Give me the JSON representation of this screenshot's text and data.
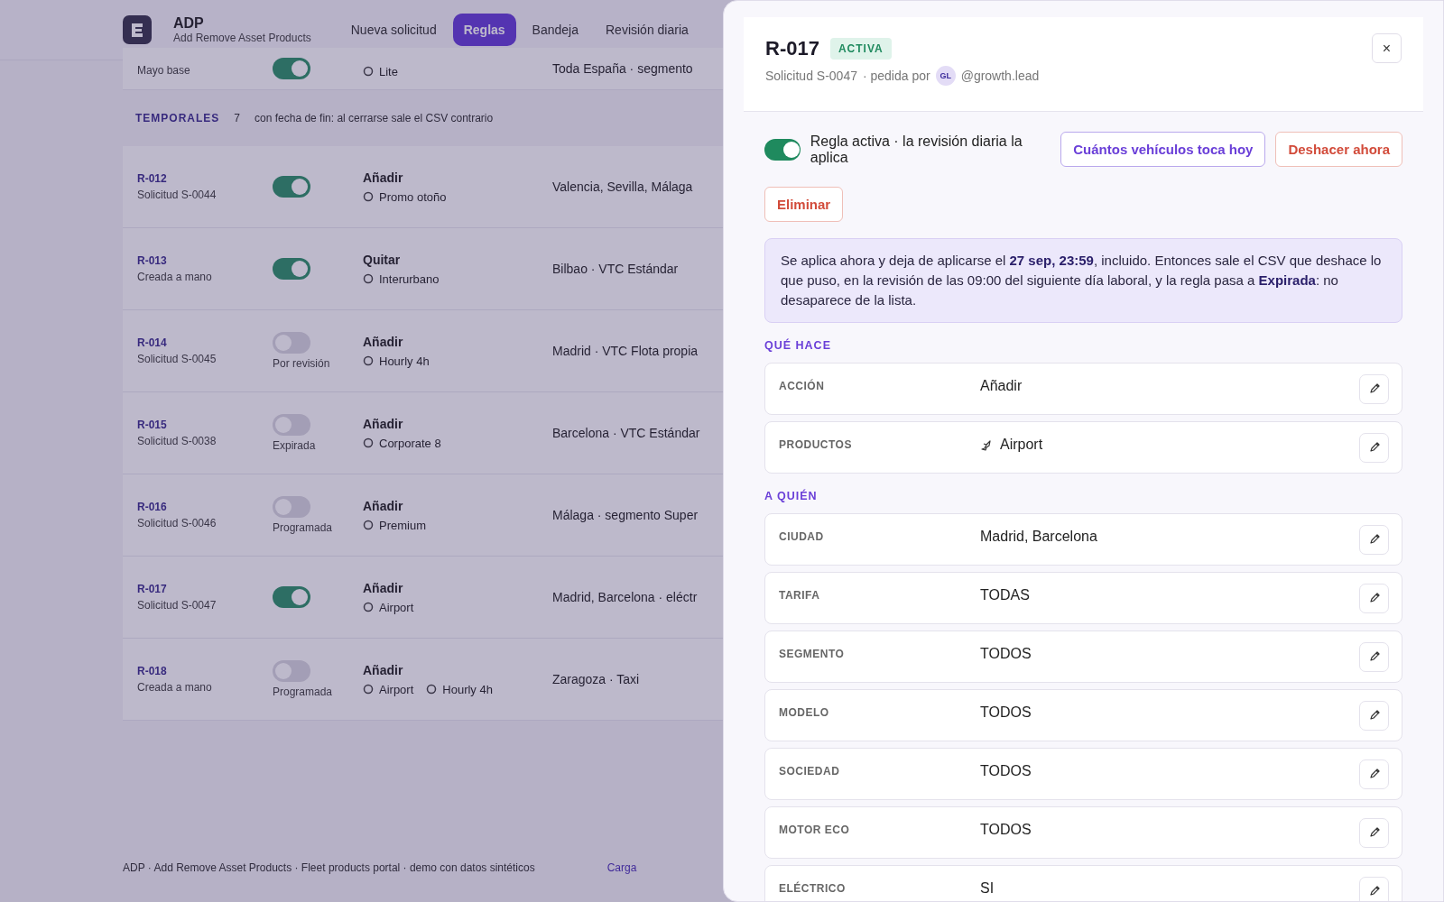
{
  "app": {
    "brand": "ADP",
    "subtitle": "Add Remove Asset Products",
    "nav": [
      {
        "label": "Nueva solicitud",
        "selected": false
      },
      {
        "label": "Reglas",
        "selected": true
      },
      {
        "label": "Bandeja",
        "selected": false
      },
      {
        "label": "Revisión diaria",
        "selected": false
      }
    ]
  },
  "rules_list": {
    "partial_row": {
      "sub": "Mayo base",
      "on": true,
      "product": "Lite",
      "target": "Toda España · segmento"
    },
    "section": {
      "title": "TEMPORALES",
      "count": "7",
      "note": "con fecha de fin: al cerrarse sale el CSV contrario"
    },
    "rows": [
      {
        "id": "R-012",
        "sub": "Solicitud S-0044",
        "on": true,
        "action": "Añadir",
        "products": [
          "Promo otoño"
        ],
        "target": "Valencia, Sevilla, Málaga"
      },
      {
        "id": "R-013",
        "sub": "Creada a mano",
        "on": true,
        "action": "Quitar",
        "products": [
          "Interurbano"
        ],
        "target": "Bilbao · VTC Estándar"
      },
      {
        "id": "R-014",
        "sub": "Solicitud S-0045",
        "on": false,
        "status": "Por revisión",
        "action": "Añadir",
        "products": [
          "Hourly 4h"
        ],
        "target": "Madrid · VTC Flota propia"
      },
      {
        "id": "R-015",
        "sub": "Solicitud S-0038",
        "on": false,
        "status": "Expirada",
        "action": "Añadir",
        "products": [
          "Corporate 8"
        ],
        "target": "Barcelona · VTC Estándar"
      },
      {
        "id": "R-016",
        "sub": "Solicitud S-0046",
        "on": false,
        "status": "Programada",
        "action": "Añadir",
        "products": [
          "Premium"
        ],
        "target": "Málaga · segmento Super"
      },
      {
        "id": "R-017",
        "sub": "Solicitud S-0047",
        "on": true,
        "action": "Añadir",
        "products": [
          "Airport"
        ],
        "target": "Madrid, Barcelona · eléctr"
      },
      {
        "id": "R-018",
        "sub": "Creada a mano",
        "on": false,
        "status": "Programada",
        "action": "Añadir",
        "products": [
          "Airport",
          "Hourly 4h"
        ],
        "target": "Zaragoza · Taxi"
      }
    ]
  },
  "footer": {
    "text": "ADP · Add Remove Asset Products · Fleet products portal · demo con datos sintéticos",
    "link": "Carga"
  },
  "panel": {
    "title": "R-017",
    "badge": "ACTIVA",
    "request": "Solicitud S-0047",
    "requested_by": "· pedida por",
    "avatar": "GL",
    "user": "@growth.lead",
    "close": "×",
    "active": true,
    "active_label": "Regla activa · la revisión diaria la aplica",
    "buttons": [
      {
        "label": "Cuántos vehículos toca hoy",
        "kind": "primary"
      },
      {
        "label": "Deshacer ahora",
        "kind": "danger"
      },
      {
        "label": "Eliminar",
        "kind": "danger"
      }
    ],
    "info": "Se aplica ahora y deja de aplicarse el **27 sep, 23:59**, incluido. Entonces sale el CSV que deshace lo que puso, en la revisión de las 09:00 del siguiente día laboral, y la regla pasa a **Expirada**: no desaparece de la lista.",
    "sections": [
      {
        "title": "QUÉ HACE",
        "fields": [
          {
            "label": "ACCIÓN",
            "value": "Añadir",
            "kind": "text"
          },
          {
            "label": "PRODUCTOS",
            "value": "Airport",
            "kind": "product"
          }
        ]
      },
      {
        "title": "A QUIÉN",
        "fields": [
          {
            "label": "CIUDAD",
            "value": "Madrid, Barcelona",
            "kind": "text"
          },
          {
            "label": "TARIFA",
            "value": "TODAS",
            "kind": "text"
          },
          {
            "label": "SEGMENTO",
            "value": "TODOS",
            "kind": "text"
          },
          {
            "label": "MODELO",
            "value": "TODOS",
            "kind": "text"
          },
          {
            "label": "SOCIEDAD",
            "value": "TODOS",
            "kind": "text"
          },
          {
            "label": "MOTOR ECO",
            "value": "TODOS",
            "kind": "text"
          },
          {
            "label": "ELÉCTRICO",
            "value": "SI",
            "kind": "text"
          }
        ]
      }
    ]
  }
}
